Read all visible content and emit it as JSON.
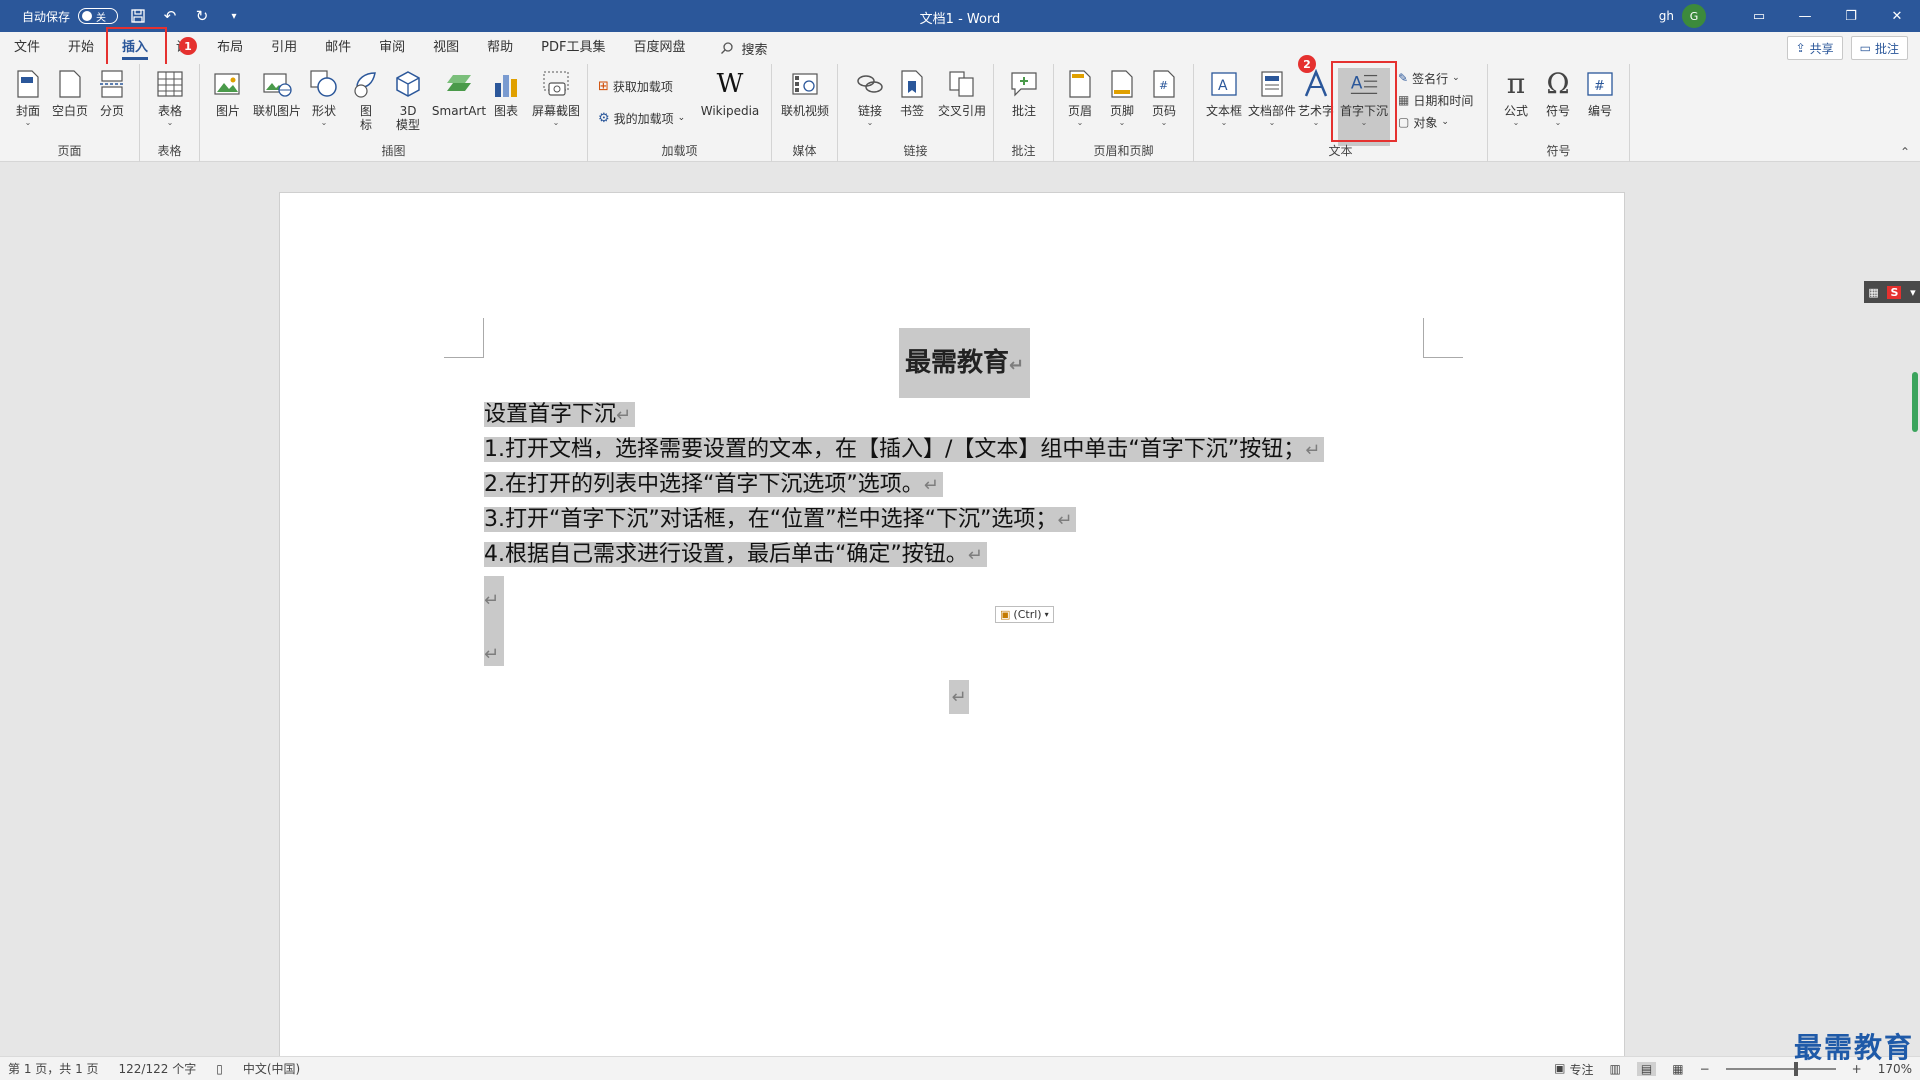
{
  "titlebar": {
    "autosave_label": "自动保存",
    "autosave_state": "关",
    "doc_title": "文档1 - Word",
    "user_name": "gh",
    "user_initial": "G"
  },
  "tabs": [
    {
      "label": "文件"
    },
    {
      "label": "开始"
    },
    {
      "label": "插入"
    },
    {
      "label": "设"
    },
    {
      "label": "布局"
    },
    {
      "label": "引用"
    },
    {
      "label": "邮件"
    },
    {
      "label": "审阅"
    },
    {
      "label": "视图"
    },
    {
      "label": "帮助"
    },
    {
      "label": "PDF工具集"
    },
    {
      "label": "百度网盘"
    }
  ],
  "search_label": "搜索",
  "share_label": "共享",
  "comment_label": "批注",
  "badges": {
    "one": "1",
    "two": "2"
  },
  "ribbon": {
    "groups": {
      "pages": "页面",
      "tables": "表格",
      "illustrations": "插图",
      "addins": "加载项",
      "media": "媒体",
      "links": "链接",
      "comments": "批注",
      "header_footer": "页眉和页脚",
      "text": "文本",
      "symbols": "符号"
    },
    "buttons": {
      "cover": "封面",
      "blank_page": "空白页",
      "page_break": "分页",
      "table": "表格",
      "picture": "图片",
      "online_picture": "联机图片",
      "shapes": "形状",
      "icons_a": "图",
      "icons_b": "标",
      "model3d_a": "3D",
      "model3d_b": "模型",
      "smartart": "SmartArt",
      "chart": "图表",
      "screenshot": "屏幕截图",
      "get_addins": "获取加载项",
      "my_addins": "我的加载项",
      "wikipedia": "Wikipedia",
      "online_video": "联机视频",
      "link": "链接",
      "bookmark": "书签",
      "cross_ref": "交叉引用",
      "comment": "批注",
      "header": "页眉",
      "footer": "页脚",
      "page_number": "页码",
      "text_box": "文本框",
      "quick_parts": "文档部件",
      "wordart": "艺术字",
      "drop_cap": "首字下沉",
      "signature_line": "签名行",
      "date_time": "日期和时间",
      "object": "对象",
      "equation": "公式",
      "symbol": "符号",
      "number": "编号"
    }
  },
  "document": {
    "title": "最需教育",
    "lines": [
      "设置首字下沉",
      "1.打开文档，选择需要设置的文本，在【插入】/【文本】组中单击“首字下沉”按钮；",
      "2.在打开的列表中选择“首字下沉选项”选项。",
      "3.打开“首字下沉”对话框，在“位置”栏中选择“下沉”选项；",
      "4.根据自己需求进行设置，最后单击“确定”按钮。"
    ],
    "paragraph_mark": "↵",
    "paste_tip": "(Ctrl)"
  },
  "statusbar": {
    "page_info": "第 1 页，共 1 页",
    "word_count": "122/122 个字",
    "language": "中文(中国)",
    "focus": "专注",
    "zoom": "170%"
  },
  "watermark": "最需教育"
}
